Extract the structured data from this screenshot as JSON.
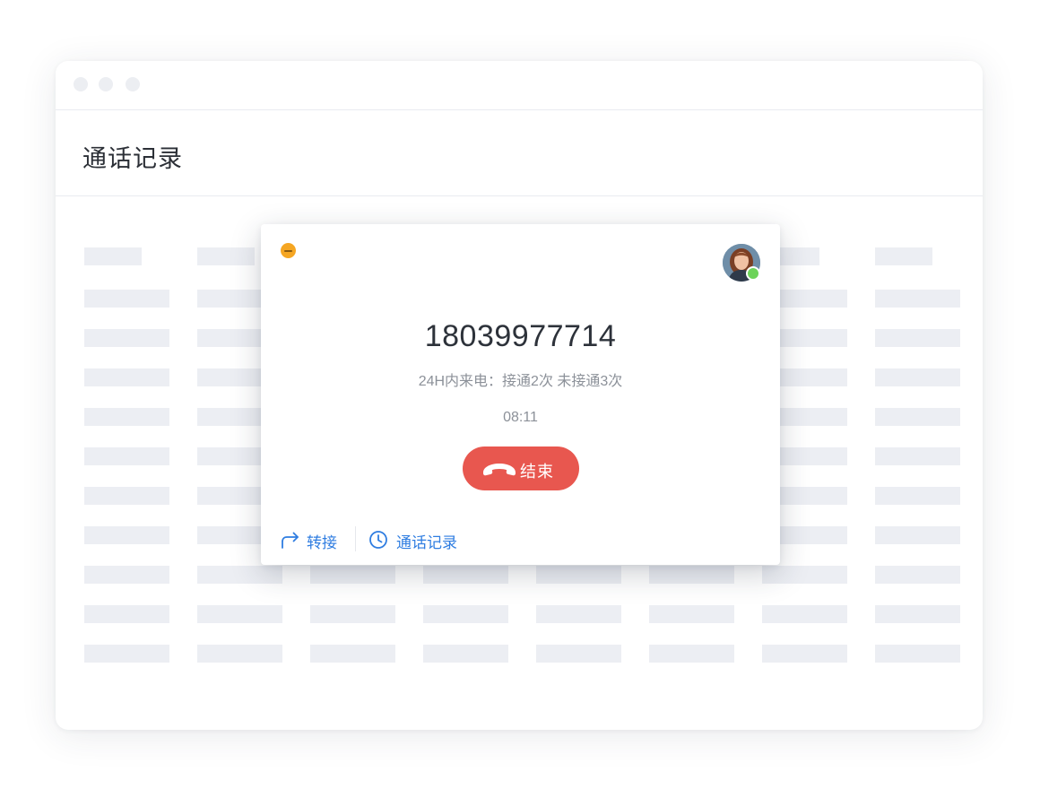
{
  "window": {
    "title": "通话记录"
  },
  "call": {
    "phone_number": "18039977714",
    "stats": "24H内来电：接通2次   未接通3次",
    "timer": "08:11",
    "end_button_label": "结束",
    "agent_status": "online"
  },
  "actions": {
    "transfer_label": "转接",
    "history_label": "通话记录"
  },
  "colors": {
    "accent": "#2f7de1",
    "end_call": "#e8574f",
    "minimize": "#f5a623",
    "online": "#6dd35a",
    "skeleton": "#eceef3"
  },
  "icons": {
    "minimize": "minimize-icon",
    "avatar": "avatar",
    "hangup": "hangup-phone-icon",
    "transfer": "share-arrow-icon",
    "history": "clock-icon"
  }
}
